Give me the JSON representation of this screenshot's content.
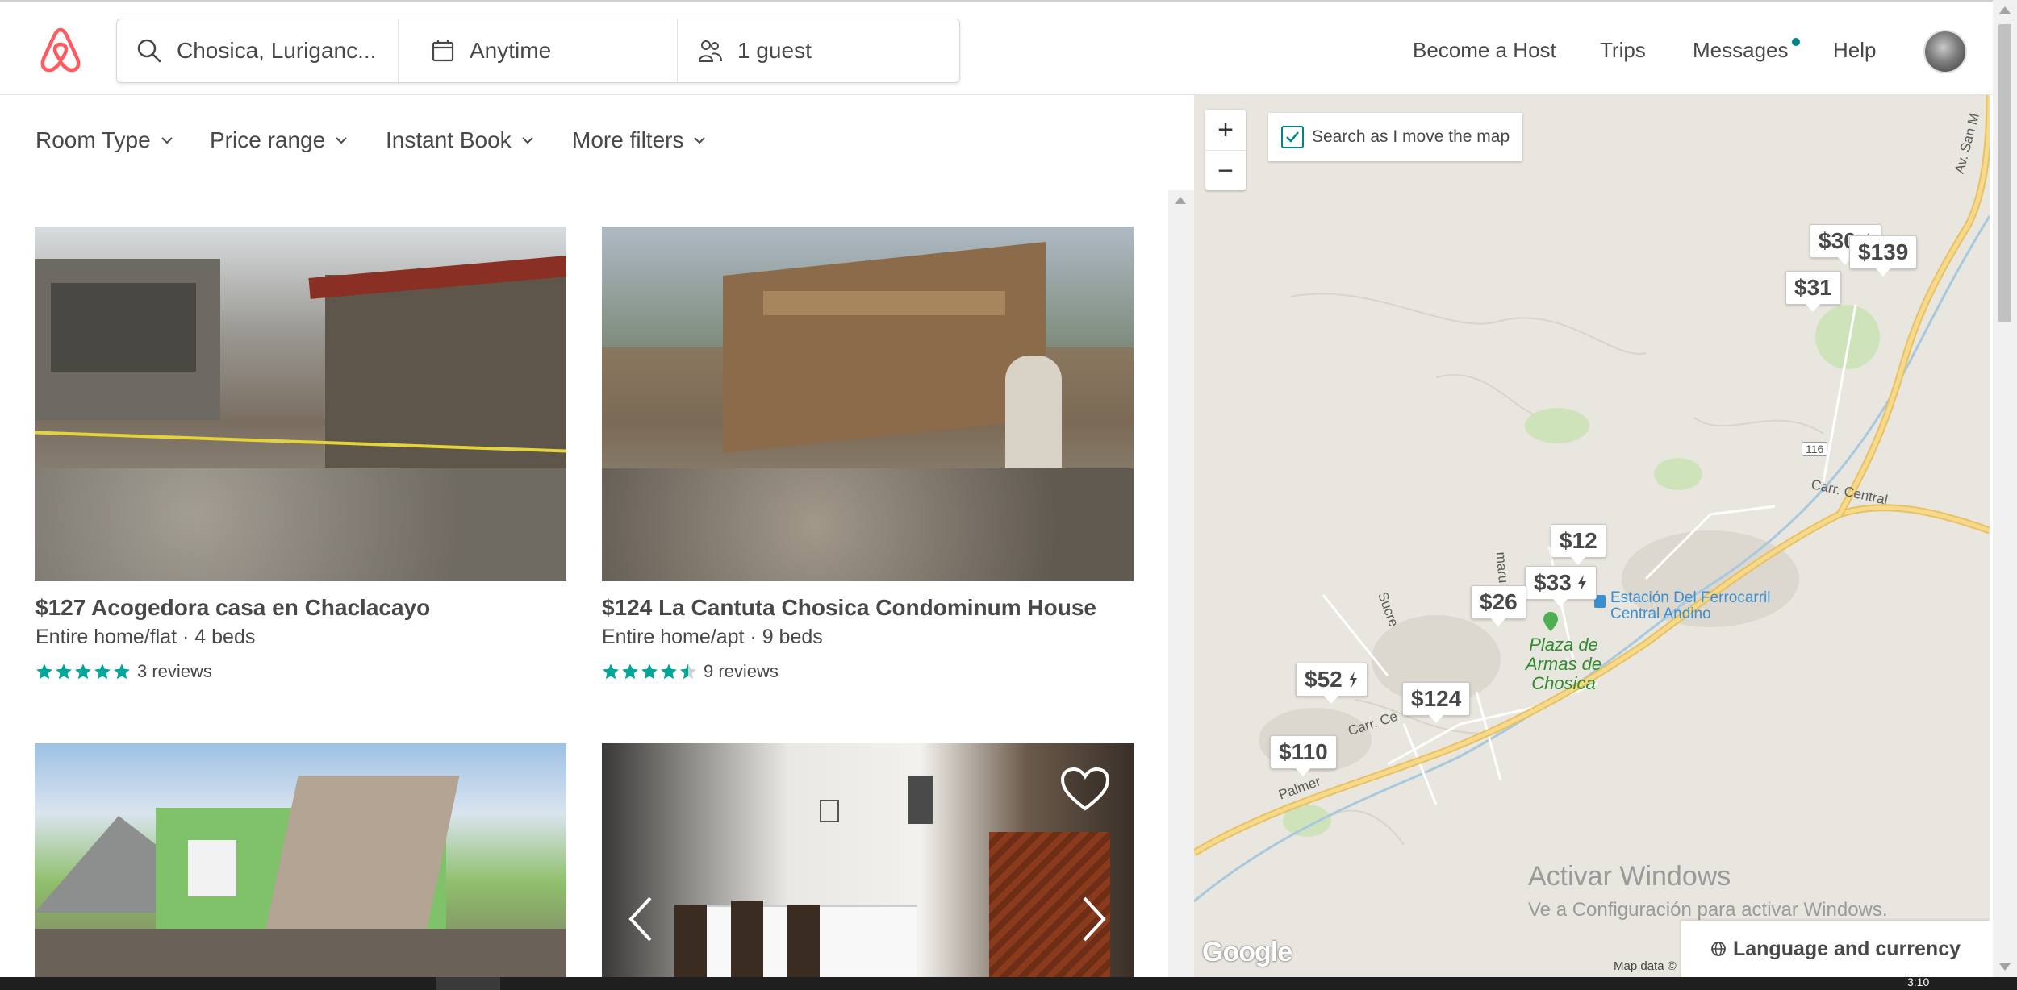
{
  "header": {
    "search": {
      "location": "Chosica, Luriganc...",
      "dates": "Anytime",
      "guests": "1 guest"
    },
    "nav": {
      "become_host": "Become a Host",
      "trips": "Trips",
      "messages": "Messages",
      "help": "Help"
    },
    "messages_has_unread": true
  },
  "filters": [
    {
      "label": "Room Type"
    },
    {
      "label": "Price range"
    },
    {
      "label": "Instant Book"
    },
    {
      "label": "More filters"
    }
  ],
  "listings": [
    {
      "price": "$127",
      "name": "Acogedora casa en Chaclacayo",
      "title": "$127 Acogedora casa en Chaclacayo",
      "details": "Entire home/flat · 4 beds",
      "rating": 5,
      "reviews": "3 reviews"
    },
    {
      "price": "$124",
      "name": "La Cantuta Chosica Condominum House",
      "title": "$124 La Cantuta Chosica Condominum House",
      "details": "Entire home/apt · 9 beds",
      "rating": 4.5,
      "reviews": "9 reviews"
    },
    {
      "title": "",
      "details": ""
    },
    {
      "title": "",
      "details": ""
    }
  ],
  "map": {
    "search_as_move_label": "Search as I move the map",
    "search_as_move_checked": true,
    "zoom_in": "+",
    "zoom_out": "−",
    "pins": [
      {
        "price": "$30",
        "instant": true
      },
      {
        "price": "$139",
        "instant": false
      },
      {
        "price": "$31",
        "instant": false
      },
      {
        "price": "$12",
        "instant": false
      },
      {
        "price": "$33",
        "instant": true
      },
      {
        "price": "$26",
        "instant": false
      },
      {
        "price": "$52",
        "instant": true
      },
      {
        "price": "$124",
        "instant": false
      },
      {
        "price": "$110",
        "instant": false
      }
    ],
    "labels": {
      "road_central": "Carr. Central",
      "road_ce": "Carr. Ce",
      "av_san": "Av. San M",
      "sucre": "Sucre",
      "amaru": "maru",
      "palmer": "Palmer",
      "plaza": "Plaza de Armas de Chosica",
      "station": "Estación Del Ferrocarril Central Andino",
      "shield_116": "116"
    },
    "watermark_line1": "Activar Windows",
    "watermark_line2": "Ve a Configuración para activar Windows.",
    "google": "Google",
    "map_data": "Map data ©",
    "language_button": "Language and currency"
  },
  "colors": {
    "brand": "#FF5A5F",
    "accent": "#008489",
    "text": "#484848",
    "map_bg": "#E9E6DF",
    "road": "#F6D27A"
  },
  "system": {
    "clock": "3:10"
  }
}
